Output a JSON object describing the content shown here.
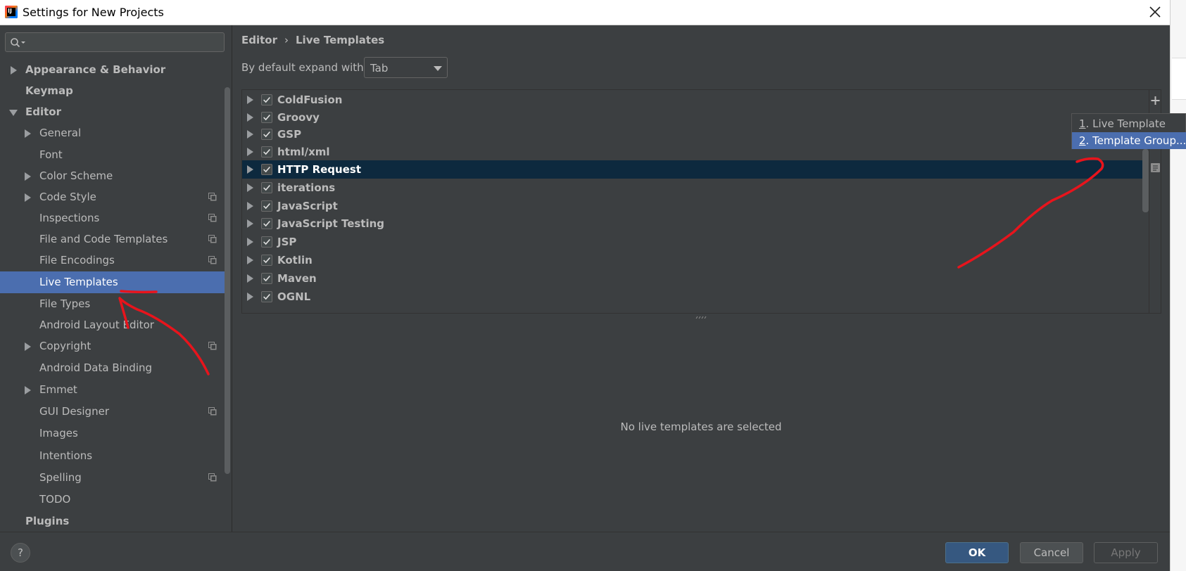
{
  "window": {
    "title": "Settings for New Projects",
    "icons": {
      "close": "close-icon",
      "logo": "intellij-idea-logo"
    }
  },
  "search": {
    "placeholder": "",
    "icon": "search-icon"
  },
  "sidebar": {
    "items": [
      {
        "label": "Appearance & Behavior"
      },
      {
        "label": "Keymap"
      },
      {
        "label": "Editor"
      },
      {
        "label": "General"
      },
      {
        "label": "Font"
      },
      {
        "label": "Color Scheme"
      },
      {
        "label": "Code Style"
      },
      {
        "label": "Inspections"
      },
      {
        "label": "File and Code Templates"
      },
      {
        "label": "File Encodings"
      },
      {
        "label": "Live Templates"
      },
      {
        "label": "File Types"
      },
      {
        "label": "Android Layout Editor"
      },
      {
        "label": "Copyright"
      },
      {
        "label": "Android Data Binding"
      },
      {
        "label": "Emmet"
      },
      {
        "label": "GUI Designer"
      },
      {
        "label": "Images"
      },
      {
        "label": "Intentions"
      },
      {
        "label": "Spelling"
      },
      {
        "label": "TODO"
      },
      {
        "label": "Plugins"
      }
    ]
  },
  "main": {
    "breadcrumb": {
      "part1": "Editor",
      "separator": "›",
      "part2": "Live Templates"
    },
    "expand_label": "By default expand with",
    "expand_value": "Tab",
    "template_groups": [
      {
        "name": "ColdFusion",
        "checked": true
      },
      {
        "name": "Groovy",
        "checked": true
      },
      {
        "name": "GSP",
        "checked": true
      },
      {
        "name": "html/xml",
        "checked": true
      },
      {
        "name": "HTTP Request",
        "checked": true
      },
      {
        "name": "iterations",
        "checked": true
      },
      {
        "name": "JavaScript",
        "checked": true
      },
      {
        "name": "JavaScript Testing",
        "checked": true
      },
      {
        "name": "JSP",
        "checked": true
      },
      {
        "name": "Kotlin",
        "checked": true
      },
      {
        "name": "Maven",
        "checked": true
      },
      {
        "name": "OGNL",
        "checked": true
      }
    ],
    "empty_message": "No live templates are selected"
  },
  "add_menu": {
    "items": [
      {
        "mnemonic": "1",
        "text": ". Live Template"
      },
      {
        "mnemonic": "2",
        "text": ". Template Group..."
      }
    ]
  },
  "footer": {
    "help_label": "?",
    "ok_label": "OK",
    "cancel_label": "Cancel",
    "apply_label": "Apply"
  },
  "colors": {
    "panel_bg": "#3c3f41",
    "selection": "#4b6eaf",
    "list_selection": "#0d293e",
    "text": "#bbbbbb",
    "annotation": "#e8141c"
  }
}
